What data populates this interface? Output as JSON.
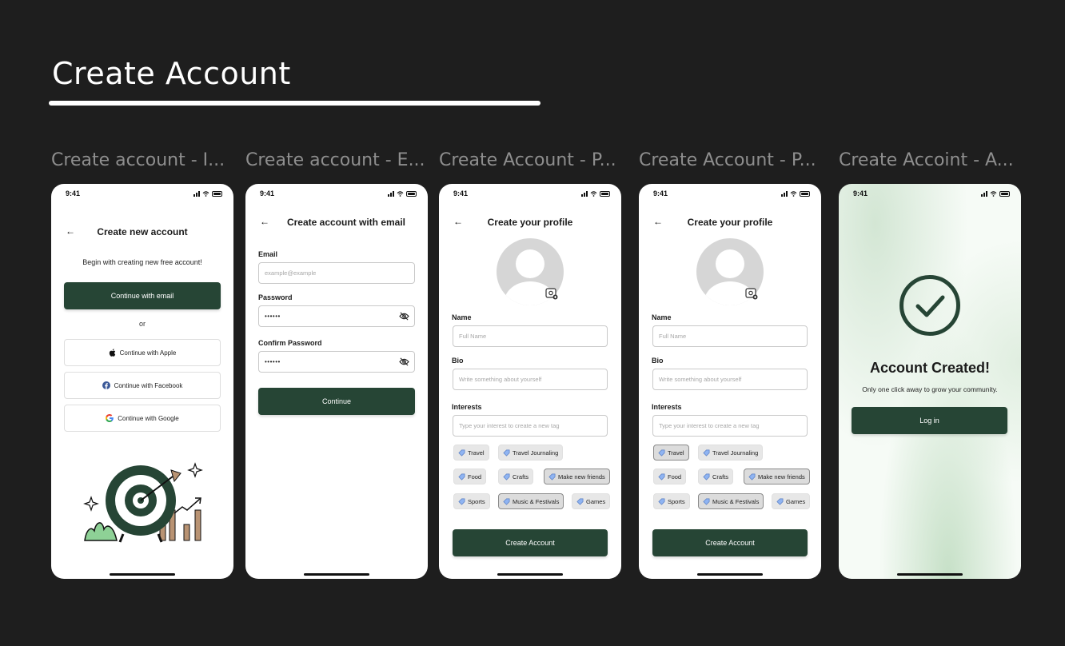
{
  "header": {
    "title": "Create Account"
  },
  "frames": [
    {
      "label": "Create account - I..."
    },
    {
      "label": "Create account - E..."
    },
    {
      "label": "Create Account - P..."
    },
    {
      "label": "Create Account - P..."
    },
    {
      "label": "Create Accoint - A..."
    }
  ],
  "status_time": "9:41",
  "back_arrow": "←",
  "screen1": {
    "title": "Create new account",
    "subtitle": "Begin with creating new free account!",
    "email_button": "Continue with email",
    "or": "or",
    "apple_button": "Continue with Apple",
    "facebook_button": "Continue with Facebook",
    "google_button": "Continue with Google",
    "icons": {
      "apple": "apple-icon",
      "facebook": "facebook-icon",
      "google": "google-icon",
      "illustration": "target-growth-illustration"
    }
  },
  "screen2": {
    "title": "Create account with email",
    "email_label": "Email",
    "email_placeholder": "example@example",
    "password_label": "Password",
    "password_value": "••••••",
    "confirm_label": "Confirm Password",
    "confirm_value": "••••••",
    "continue_button": "Continue"
  },
  "profile": {
    "title": "Create your profile",
    "name_label": "Name",
    "name_placeholder": "Full Name",
    "bio_label": "Bio",
    "bio_placeholder": "Write something about yourself",
    "interests_label": "Interests",
    "interests_placeholder": "Type your interest to create a new tag",
    "tags": [
      "Travel",
      "Travel Journaling",
      "Food",
      "Crafts",
      "Make new friends",
      "Sports",
      "Music & Festivals",
      "Games"
    ],
    "screen3_selected": [
      "Make new friends",
      "Music & Festivals"
    ],
    "screen4_selected": [
      "Travel",
      "Make new friends",
      "Music & Festivals"
    ],
    "create_button": "Create Account"
  },
  "screen5": {
    "title": "Account Created!",
    "subtitle": "Only one click away to grow your community.",
    "login_button": "Log in"
  },
  "colors": {
    "background": "#1e1e1e",
    "primary": "#264535",
    "label": "#8e8e8e"
  }
}
